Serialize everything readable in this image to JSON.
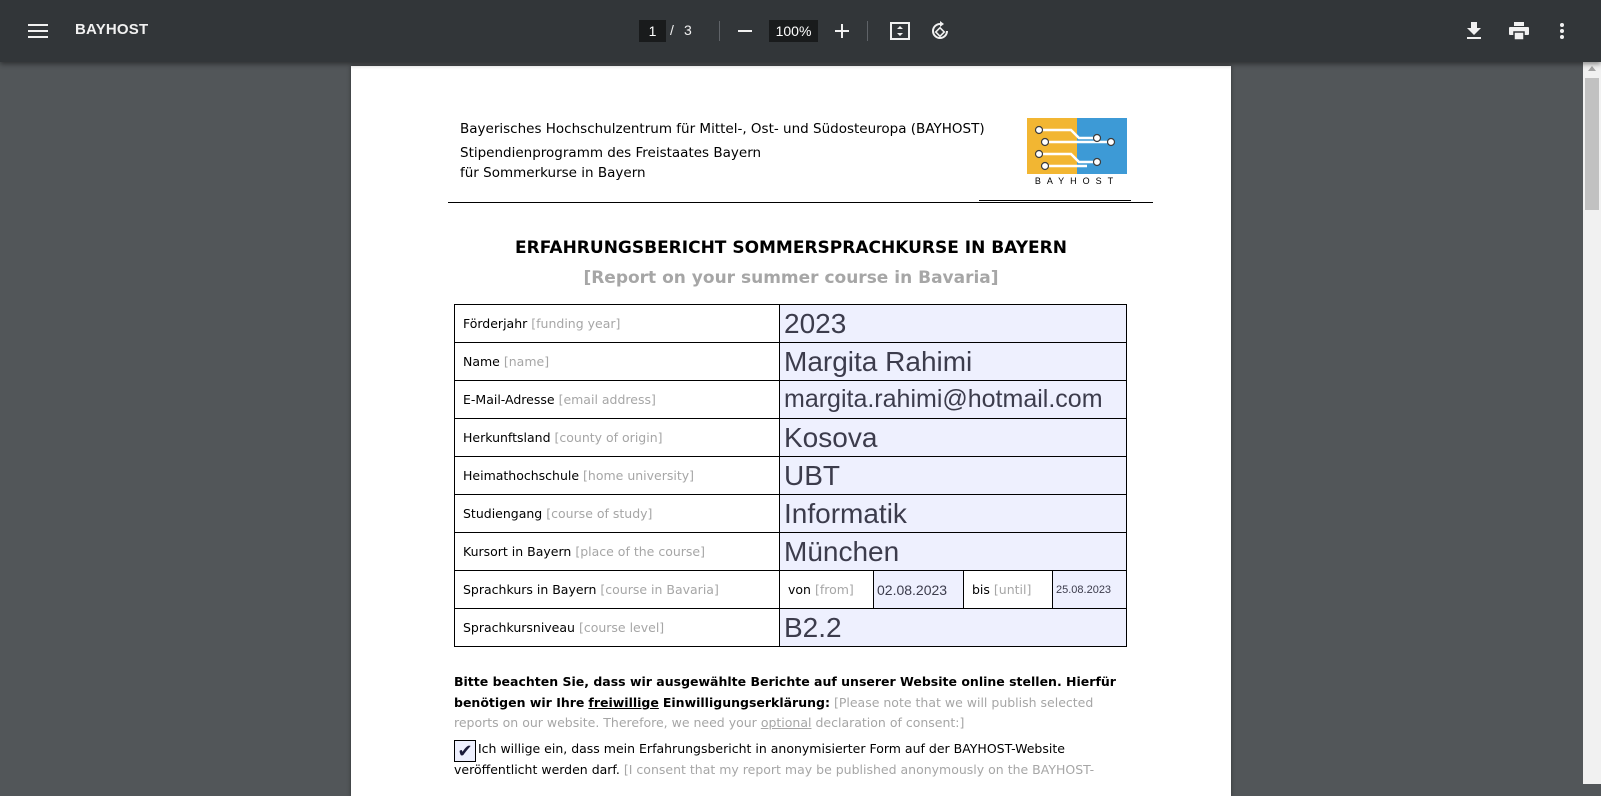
{
  "toolbar": {
    "title": "BAYHOST",
    "page_current": "1",
    "page_separator": "/",
    "page_total": "3",
    "zoom": "100%"
  },
  "header": {
    "line1": "Bayerisches Hochschulzentrum für Mittel-, Ost- und Südosteuropa (BAYHOST)",
    "line2": "Stipendienprogramm des Freistaates Bayern",
    "line3": "für Sommerkurse in Bayern",
    "logo_text": "BAYHOST"
  },
  "document": {
    "title": "ERFAHRUNGSBERICHT SOMMERSPRACHKURSE IN BAYERN",
    "subtitle": "[Report on your summer course in Bavaria]"
  },
  "form": {
    "rows": [
      {
        "label": "Förderjahr",
        "label_en": "[funding year]",
        "value": "2023"
      },
      {
        "label": "Name",
        "label_en": "[name]",
        "value": "Margita Rahimi"
      },
      {
        "label": "E-Mail-Adresse",
        "label_en": "[email address]",
        "value": "margita.rahimi@hotmail.com"
      },
      {
        "label": "Herkunftsland",
        "label_en": "[county of origin]",
        "value": "Kosova"
      },
      {
        "label": "Heimathochschule",
        "label_en": "[home university]",
        "value": "UBT"
      },
      {
        "label": "Studiengang",
        "label_en": "[course of study]",
        "value": "Informatik"
      },
      {
        "label": "Kursort in Bayern",
        "label_en": "[place of the course]",
        "value": "München"
      }
    ],
    "course_row": {
      "label": "Sprachkurs in Bayern",
      "label_en": "[course in Bavaria]",
      "from_label": "von",
      "from_label_en": "[from]",
      "from_value": "02.08.2023",
      "until_label": "bis",
      "until_label_en": "[until]",
      "until_value": "25.08.2023"
    },
    "level_row": {
      "label": "Sprachkursniveau",
      "label_en": "[course level]",
      "value": "B2.2"
    }
  },
  "notice": {
    "bold_a": "Bitte beachten Sie, dass wir ausgewählte Berichte auf unserer Website online stellen. Hierfür benötigen wir Ihre",
    "bold_underline": "freiwillige",
    "bold_b": "Einwilligungserklärung:",
    "en_a": "[Please note that we will publish selected reports on our website. Therefore, we need your",
    "en_underline": "optional",
    "en_b": "declaration of consent:]"
  },
  "consent": {
    "checked_glyph": "✔",
    "text": "Ich willige ein, dass mein Erfahrungsbericht in anonymisierter Form auf der BAYHOST-Website veröffentlicht werden darf.",
    "text_en": "[I consent that my report may be published anonymously on the BAYHOST-"
  },
  "colors": {
    "toolbar_bg": "#323639",
    "viewer_bg": "#525659",
    "field_bg": "#eef0fe",
    "logo_yellow": "#f2b632",
    "logo_blue": "#3d9ad6"
  }
}
